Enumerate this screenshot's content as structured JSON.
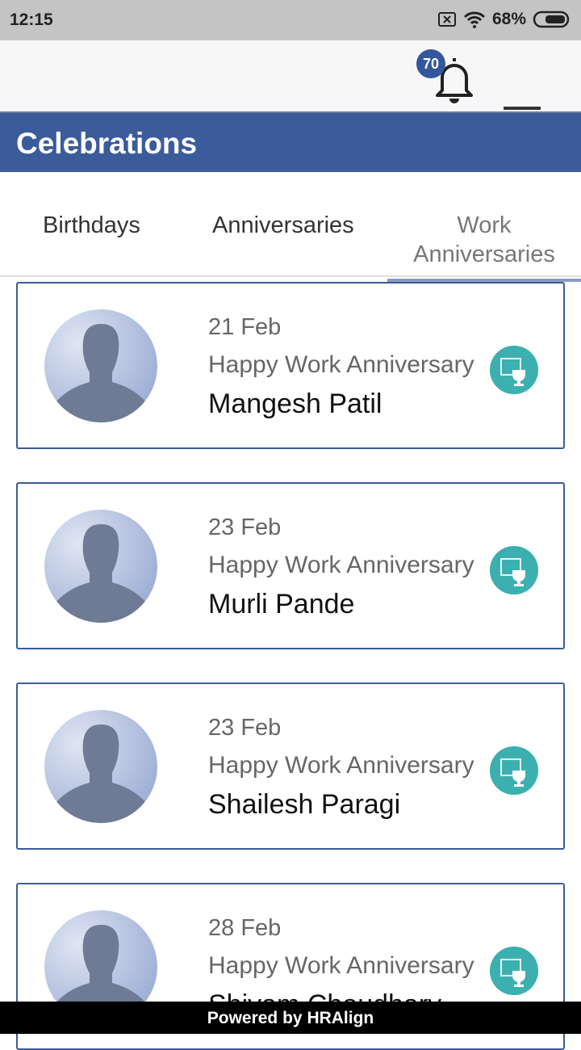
{
  "status_bar": {
    "time": "12:15",
    "battery": "68%"
  },
  "header": {
    "notification_count": "70"
  },
  "title": "Celebrations",
  "tabs": [
    {
      "label": "Birthdays"
    },
    {
      "label": "Anniversaries"
    },
    {
      "label": "Work Anniversaries",
      "active": true
    }
  ],
  "cards": [
    {
      "date": "21 Feb",
      "message": "Happy Work Anniversary",
      "name": "Mangesh Patil"
    },
    {
      "date": "23 Feb",
      "message": "Happy Work Anniversary",
      "name": "Murli Pande"
    },
    {
      "date": "23 Feb",
      "message": "Happy Work Anniversary",
      "name": "Shailesh Paragi"
    },
    {
      "date": "28 Feb",
      "message": "Happy Work Anniversary",
      "name": "Shivam Choudhary"
    }
  ],
  "footer": "Powered by HRAlign",
  "colors": {
    "primary": "#3b5b9a",
    "icon_teal": "#3cb0b0"
  }
}
